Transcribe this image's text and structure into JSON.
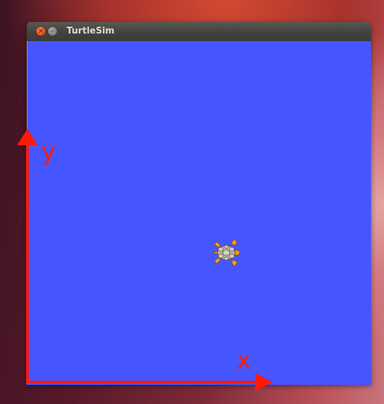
{
  "window": {
    "title": "TurtleSim",
    "close_glyph": "×",
    "minimize_glyph": "–",
    "background_color": "#4556ff"
  },
  "turtle": {
    "icon": "turtle-icon"
  },
  "axes": {
    "x_label": "x",
    "y_label": "y",
    "color": "#ff1a0a"
  },
  "colors": {
    "titlebar": "#43423e",
    "close_button": "#e15323",
    "canvas": "#4556ff",
    "axis": "#ff1a0a"
  }
}
